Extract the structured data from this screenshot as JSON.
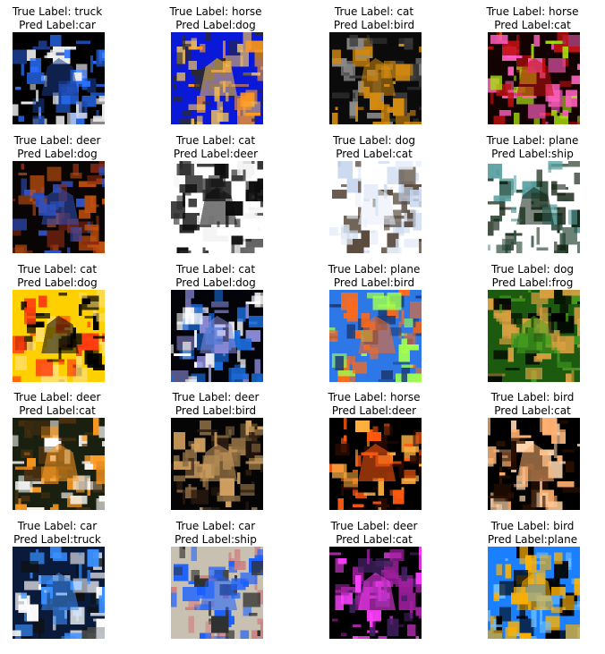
{
  "figure": {
    "panels": [
      {
        "true_label": "True Label: truck",
        "pred_label": "Pred Label:car",
        "image_icon": "truck-photo",
        "colors": [
          "#000000",
          "#1a3a8a",
          "#f0f0f0",
          "#2a70ff"
        ]
      },
      {
        "true_label": "True Label: horse",
        "pred_label": "Pred Label:dog",
        "image_icon": "horse-photo",
        "colors": [
          "#0a18d8",
          "#f0c060",
          "#2b2b2b",
          "#ff9a20"
        ]
      },
      {
        "true_label": "True Label: cat",
        "pred_label": "Pred Label:bird",
        "image_icon": "cat-photo",
        "colors": [
          "#0b0b0b",
          "#d38a10",
          "#3a3a3a",
          "#8a8a8a"
        ]
      },
      {
        "true_label": "True Label: horse",
        "pred_label": "Pred Label:cat",
        "image_icon": "horse-photo",
        "colors": [
          "#120202",
          "#c01010",
          "#a8e010",
          "#ff60c0"
        ]
      },
      {
        "true_label": "True Label: deer",
        "pred_label": "Pred Label:dog",
        "image_icon": "deer-photo",
        "colors": [
          "#0a0505",
          "#3050c0",
          "#c05010",
          "#8a2a10"
        ]
      },
      {
        "true_label": "True Label: cat",
        "pred_label": "Pred Label:deer",
        "image_icon": "cat-photo",
        "colors": [
          "#ffffff",
          "#0d0d0d",
          "#2a2a2a",
          "#f3f3f3"
        ]
      },
      {
        "true_label": "True Label: dog",
        "pred_label": "Pred Label:cat",
        "image_icon": "dog-photo",
        "colors": [
          "#ffffff",
          "#e7eef9",
          "#5a4b3e",
          "#c8d7ee"
        ]
      },
      {
        "true_label": "True Label: plane",
        "pred_label": "Pred Label:ship",
        "image_icon": "plane-photo",
        "colors": [
          "#ffffff",
          "#112211",
          "#5aa0a0",
          "#2a4a3a"
        ]
      },
      {
        "true_label": "True Label: cat",
        "pred_label": "Pred Label:dog",
        "image_icon": "cat-photo",
        "colors": [
          "#ffd000",
          "#000000",
          "#ff3a10",
          "#ffe070"
        ]
      },
      {
        "true_label": "True Label: cat",
        "pred_label": "Pred Label:dog",
        "image_icon": "cat-photo",
        "colors": [
          "#02040a",
          "#8a8ad8",
          "#ffffff",
          "#1a6ad8"
        ]
      },
      {
        "true_label": "True Label: plane",
        "pred_label": "Pred Label:bird",
        "image_icon": "plane-photo",
        "colors": [
          "#2d78e6",
          "#ff6a1a",
          "#a0ff50",
          "#1b3c7a"
        ]
      },
      {
        "true_label": "True Label: dog",
        "pred_label": "Pred Label:frog",
        "image_icon": "dog-photo",
        "colors": [
          "#1c5a10",
          "#48a020",
          "#000000",
          "#d8a040"
        ]
      },
      {
        "true_label": "True Label: deer",
        "pred_label": "Pred Label:cat",
        "image_icon": "deer-photo",
        "colors": [
          "#1a2010",
          "#ff9a20",
          "#4a3010",
          "#ffffff"
        ]
      },
      {
        "true_label": "True Label: deer",
        "pred_label": "Pred Label:bird",
        "image_icon": "deer-photo",
        "colors": [
          "#050505",
          "#d0a060",
          "#2a1a10",
          "#8a6a40"
        ]
      },
      {
        "true_label": "True Label: horse",
        "pred_label": "Pred Label:deer",
        "image_icon": "horse-photo",
        "colors": [
          "#000000",
          "#ff5a10",
          "#ffb040",
          "#2a0a00"
        ]
      },
      {
        "true_label": "True Label: bird",
        "pred_label": "Pred Label:cat",
        "image_icon": "bird-photo",
        "colors": [
          "#000000",
          "#ffb070",
          "#2a1000",
          "#ffd8b0"
        ]
      },
      {
        "true_label": "True Label: car",
        "pred_label": "Pred Label:truck",
        "image_icon": "car-photo",
        "colors": [
          "#0a1a3a",
          "#3a90ff",
          "#ffffff",
          "#101010"
        ]
      },
      {
        "true_label": "True Label: car",
        "pred_label": "Pred Label:ship",
        "image_icon": "car-photo",
        "colors": [
          "#c8c0b0",
          "#1a60ff",
          "#303030",
          "#d08080"
        ]
      },
      {
        "true_label": "True Label: deer",
        "pred_label": "Pred Label:cat",
        "image_icon": "deer-photo",
        "colors": [
          "#000000",
          "#ff40ff",
          "#402060",
          "#a020a0"
        ]
      },
      {
        "true_label": "True Label: bird",
        "pred_label": "Pred Label:plane",
        "image_icon": "bird-photo",
        "colors": [
          "#1a80ff",
          "#ffb000",
          "#000000",
          "#70c0ff"
        ]
      }
    ]
  }
}
